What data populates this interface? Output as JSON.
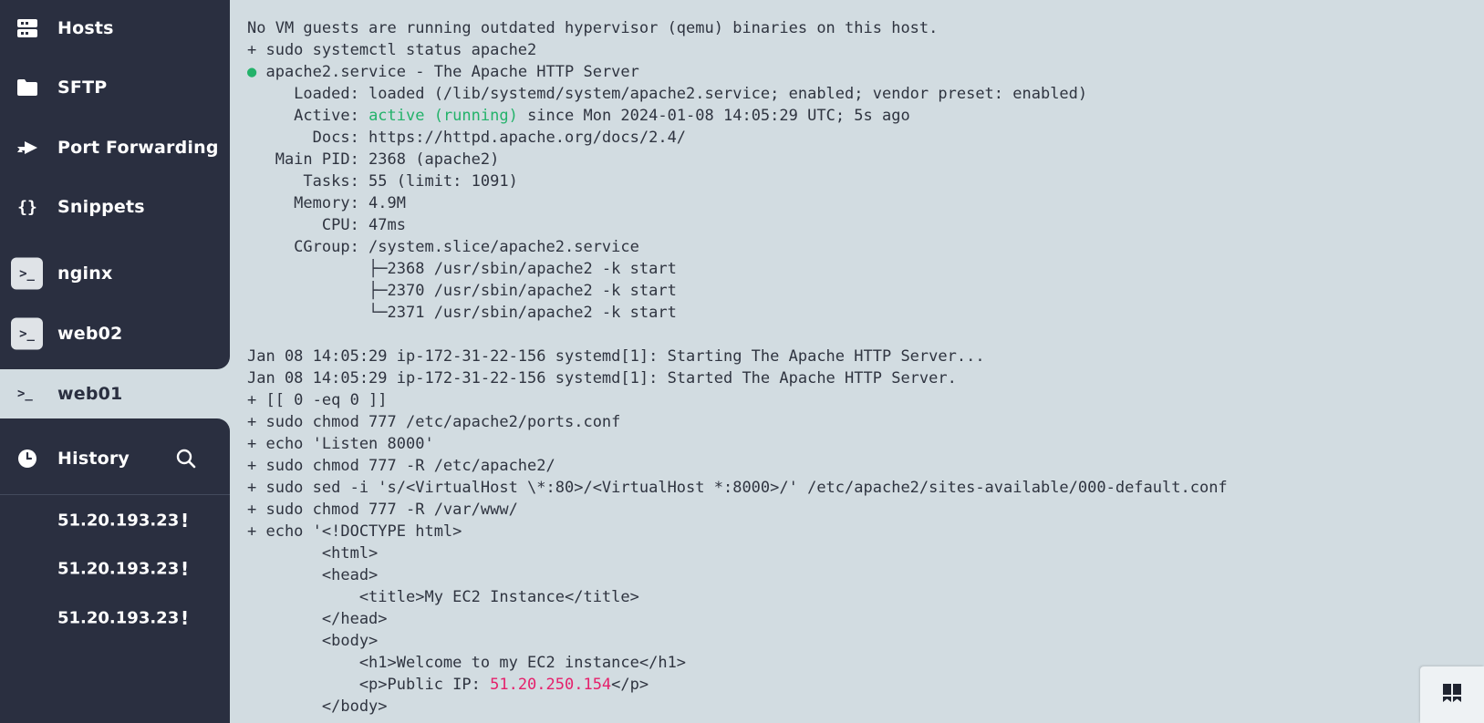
{
  "sidebar": {
    "nav": [
      {
        "label": "Hosts",
        "icon": "hosts-icon"
      },
      {
        "label": "SFTP",
        "icon": "folder-icon"
      },
      {
        "label": "Port Forwarding",
        "icon": "port-forwarding-icon"
      },
      {
        "label": "Snippets",
        "icon": "curly-braces-icon"
      }
    ],
    "sessions": [
      {
        "label": "nginx",
        "active": false
      },
      {
        "label": "web02",
        "active": false
      },
      {
        "label": "web01",
        "active": true
      }
    ],
    "terminal_glyph": ">_",
    "history": {
      "label": "History",
      "items": [
        {
          "label": "51.20.193.23",
          "badge": "!"
        },
        {
          "label": "51.20.193.23",
          "badge": "!"
        },
        {
          "label": "51.20.193.23",
          "badge": "!"
        }
      ]
    }
  },
  "terminal": {
    "lines": [
      "No VM guests are running outdated hypervisor (qemu) binaries on this host.",
      "+ sudo systemctl status apache2",
      "apache2.service - The Apache HTTP Server",
      "     Loaded: loaded (/lib/systemd/system/apache2.service; enabled; vendor preset: enabled)",
      "     Active: active (running) since Mon 2024-01-08 14:05:29 UTC; 5s ago",
      "       Docs: https://httpd.apache.org/docs/2.4/",
      "   Main PID: 2368 (apache2)",
      "      Tasks: 55 (limit: 1091)",
      "     Memory: 4.9M",
      "        CPU: 47ms",
      "     CGroup: /system.slice/apache2.service",
      "             ├─2368 /usr/sbin/apache2 -k start",
      "             ├─2370 /usr/sbin/apache2 -k start",
      "             └─2371 /usr/sbin/apache2 -k start",
      "",
      "Jan 08 14:05:29 ip-172-31-22-156 systemd[1]: Starting The Apache HTTP Server...",
      "Jan 08 14:05:29 ip-172-31-22-156 systemd[1]: Started The Apache HTTP Server.",
      "+ [[ 0 -eq 0 ]]",
      "+ sudo chmod 777 /etc/apache2/ports.conf",
      "+ echo 'Listen 8000'",
      "+ sudo chmod 777 -R /etc/apache2/",
      "+ sudo sed -i 's/<VirtualHost \\*:80>/<VirtualHost *:8000>/' /etc/apache2/sites-available/000-default.conf",
      "+ sudo chmod 777 -R /var/www/",
      "+ echo '<!DOCTYPE html>",
      "        <html>",
      "        <head>",
      "            <title>My EC2 Instance</title>",
      "        </head>",
      "        <body>",
      "            <h1>Welcome to my EC2 instance</h1>",
      "            <p>Public IP: 51.20.250.154</p>",
      "        </body>"
    ],
    "bullet": "●",
    "active_status": "active (running)",
    "public_ip": "51.20.250.154",
    "colors": {
      "green": "#23b26a",
      "pink": "#e5206b",
      "text": "#2f3440",
      "background": "#d2dce1"
    }
  },
  "widget": {
    "icon": "layout-panel-icon"
  },
  "colors": {
    "sidebar": "#2a2f40",
    "active_tab": "#d2dce1"
  }
}
